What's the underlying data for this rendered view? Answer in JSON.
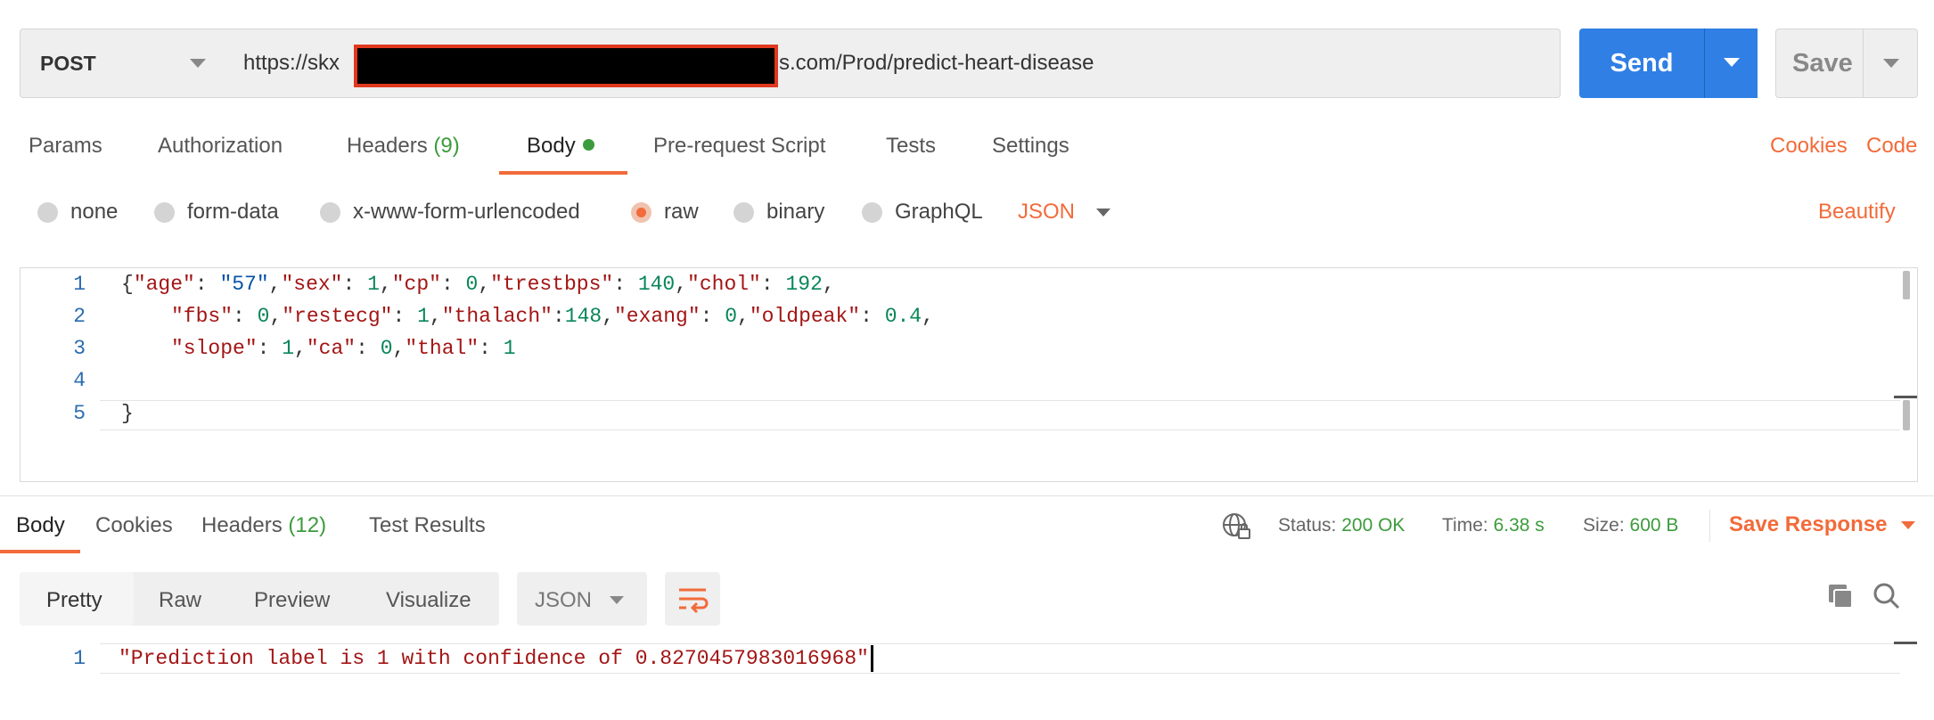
{
  "request": {
    "method": "POST",
    "url_prefix": "https://skx",
    "url_suffix": "s.com/Prod/predict-heart-disease",
    "send_label": "Send",
    "save_label": "Save"
  },
  "request_tabs": {
    "params": "Params",
    "authorization": "Authorization",
    "headers": "Headers",
    "headers_count": "(9)",
    "body": "Body",
    "pre_request": "Pre-request Script",
    "tests": "Tests",
    "settings": "Settings",
    "cookies": "Cookies",
    "code": "Code"
  },
  "body_types": {
    "none": "none",
    "form_data": "form-data",
    "urlencoded": "x-www-form-urlencoded",
    "raw": "raw",
    "binary": "binary",
    "graphql": "GraphQL",
    "format": "JSON",
    "beautify": "Beautify",
    "selected": "raw"
  },
  "editor": {
    "line_numbers": [
      "1",
      "2",
      "3",
      "4",
      "5"
    ],
    "line1": {
      "t1": "{",
      "k_age": "\"age\"",
      "c1": ": ",
      "v_age": "\"57\"",
      "c2": ",",
      "k_sex": "\"sex\"",
      "c3": ": ",
      "v_sex": "1",
      "c4": ",",
      "k_cp": "\"cp\"",
      "c5": ": ",
      "v_cp": "0",
      "c6": ",",
      "k_trestbps": "\"trestbps\"",
      "c7": ": ",
      "v_trestbps": "140",
      "c8": ",",
      "k_chol": "\"chol\"",
      "c9": ": ",
      "v_chol": "192",
      "c10": ","
    },
    "line2": {
      "k_fbs": "\"fbs\"",
      "c1": ": ",
      "v_fbs": "0",
      "c2": ",",
      "k_restecg": "\"restecg\"",
      "c3": ": ",
      "v_restecg": "1",
      "c4": ",",
      "k_thalach": "\"thalach\"",
      "c5": ":",
      "v_thalach": "148",
      "c6": ",",
      "k_exang": "\"exang\"",
      "c7": ": ",
      "v_exang": "0",
      "c8": ",",
      "k_oldpeak": "\"oldpeak\"",
      "c9": ": ",
      "v_oldpeak": "0.4",
      "c10": ","
    },
    "line3": {
      "k_slope": "\"slope\"",
      "c1": ": ",
      "v_slope": "1",
      "c2": ",",
      "k_ca": "\"ca\"",
      "c3": ": ",
      "v_ca": "0",
      "c4": ",",
      "k_thal": "\"thal\"",
      "c5": ": ",
      "v_thal": "1"
    },
    "line5": "}"
  },
  "response_tabs": {
    "body": "Body",
    "cookies": "Cookies",
    "headers": "Headers",
    "headers_count": "(12)",
    "test_results": "Test Results"
  },
  "response_meta": {
    "status_label": "Status:",
    "status_value": "200 OK",
    "time_label": "Time:",
    "time_value": "6.38 s",
    "size_label": "Size:",
    "size_value": "600 B",
    "save_response": "Save Response"
  },
  "response_view": {
    "pretty": "Pretty",
    "raw": "Raw",
    "preview": "Preview",
    "visualize": "Visualize",
    "format": "JSON"
  },
  "response_body": {
    "line_number": "1",
    "text": "\"Prediction label is 1 with confidence of 0.8270457983016968\""
  },
  "colors": {
    "accent": "#f26b3a",
    "send": "#2f7fe5",
    "success": "#3c9b3c"
  }
}
